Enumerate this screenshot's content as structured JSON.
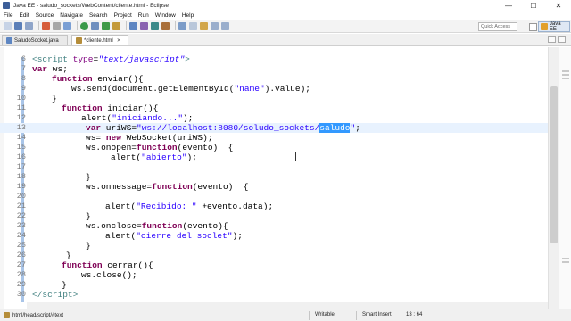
{
  "window": {
    "title": "Java EE - saludo_sockets/WebContent/cliente.html - Eclipse",
    "minimize": "—",
    "maximize": "☐",
    "close": "✕"
  },
  "menu": [
    "File",
    "Edit",
    "Source",
    "Navigate",
    "Search",
    "Project",
    "Run",
    "Window",
    "Help"
  ],
  "toolbar": {
    "quick_access_placeholder": "Quick Access",
    "perspective_label": "Java EE"
  },
  "tabs": [
    {
      "label": "SaludoSocket.java",
      "active": false,
      "dirty": false
    },
    {
      "label": "*cliente.html",
      "active": true,
      "dirty": true,
      "close": "✕"
    }
  ],
  "editor": {
    "current_line": 13,
    "lines": [
      {
        "n": "6",
        "fold": "⊖"
      },
      {
        "n": "7"
      },
      {
        "n": "8",
        "fold": "⊖"
      },
      {
        "n": "9"
      },
      {
        "n": "10"
      },
      {
        "n": "11",
        "fold": "⊖"
      },
      {
        "n": "12"
      },
      {
        "n": "13"
      },
      {
        "n": "14"
      },
      {
        "n": "15",
        "fold": "⊖"
      },
      {
        "n": "16"
      },
      {
        "n": "17"
      },
      {
        "n": "18"
      },
      {
        "n": "19",
        "fold": "⊖"
      },
      {
        "n": "20"
      },
      {
        "n": "21"
      },
      {
        "n": "22"
      },
      {
        "n": "23",
        "fold": "⊖"
      },
      {
        "n": "24"
      },
      {
        "n": "25"
      },
      {
        "n": "26"
      },
      {
        "n": "27",
        "fold": "⊖"
      },
      {
        "n": "28"
      },
      {
        "n": "29"
      },
      {
        "n": "30"
      }
    ],
    "tokens": {
      "l6_a": "<",
      "l6_tag": "script",
      "l6_attr": " type",
      "l6_eq": "=",
      "l6_val": "\"text/javascript\"",
      "l6_b": ">",
      "l7_kw": "var",
      "l7_rest": " ws;",
      "l8_kw": "function",
      "l8_rest": " enviar(){",
      "l9": "ws.send(document.getElementById(",
      "l9_str": "\"name\"",
      "l9_rest": ").value);",
      "l10": "}",
      "l11_kw": "function",
      "l11_rest": " iniciar(){",
      "l12": "alert(",
      "l12_str": "\"iniciando...\"",
      "l12_rest": ");",
      "l13_kw": "var",
      "l13_mid": " uriWS=",
      "l13_str": "\"ws://localhost:8080/soludo_sockets/",
      "l13_sel": "saludo",
      "l13_str2": "\"",
      "l13_rest": ";",
      "l14_a": "ws= ",
      "l14_kw": "new",
      "l14_rest": " WebSocket(uriWS);",
      "l15_a": "ws.onopen=",
      "l15_kw": "function",
      "l15_rest": "(evento)  {",
      "l16": "alert(",
      "l16_str": "\"abierto\"",
      "l16_rest": ");",
      "l18": "}",
      "l19_a": "ws.onmessage=",
      "l19_kw": "function",
      "l19_rest": "(evento)  {",
      "l21": "alert(",
      "l21_str": "\"Recibido: \"",
      "l21_rest": " +evento.data);",
      "l22": "}",
      "l23_a": "ws.onclose=",
      "l23_kw": "function",
      "l23_rest": "(evento){",
      "l24": "alert(",
      "l24_str": "\"cierre del soclet\"",
      "l24_rest": ");",
      "l25": "}",
      "l26": "}",
      "l27_kw": "function",
      "l27_rest": " cerrar(){",
      "l28": "ws.close();",
      "l29": "}",
      "l30_a": "</",
      "l30_tag": "script",
      "l30_b": ">"
    }
  },
  "status": {
    "path": "html/head/script/#text",
    "writable": "Writable",
    "insert_mode": "Smart Insert",
    "position": "13 : 64"
  },
  "colors": {
    "keyword": "#7f0055",
    "string": "#2a00ff",
    "tag": "#3f7f7f",
    "attribute": "#7f007f",
    "selection": "#3399ff",
    "current_line": "#e8f2fe"
  }
}
